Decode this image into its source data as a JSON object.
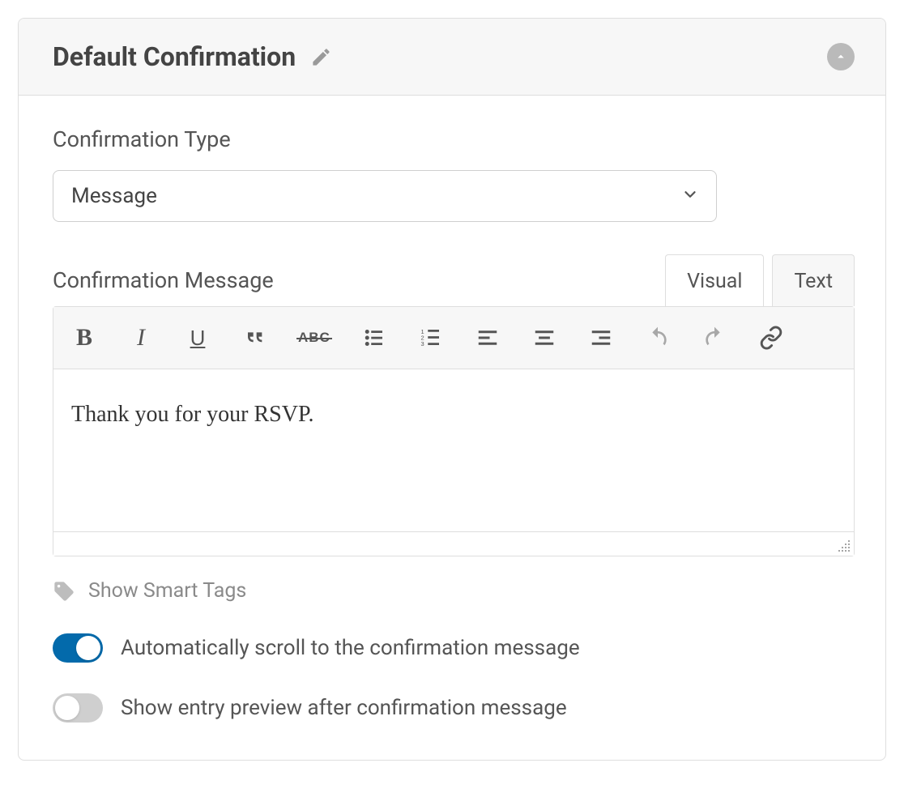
{
  "panel": {
    "title": "Default Confirmation"
  },
  "confirmation_type": {
    "label": "Confirmation Type",
    "selected": "Message"
  },
  "confirmation_message": {
    "label": "Confirmation Message",
    "value": "Thank you for your RSVP."
  },
  "tabs": {
    "visual": "Visual",
    "text": "Text"
  },
  "smart_tags": {
    "label": "Show Smart Tags"
  },
  "options": {
    "auto_scroll": {
      "label": "Automatically scroll to the confirmation message",
      "enabled": true
    },
    "entry_preview": {
      "label": "Show entry preview after confirmation message",
      "enabled": false
    }
  }
}
